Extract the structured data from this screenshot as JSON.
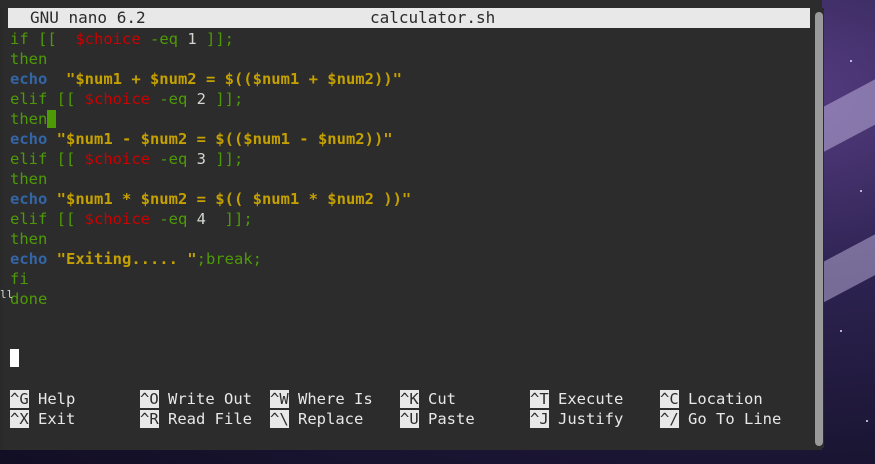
{
  "titlebar": {
    "app": "GNU nano 6.2",
    "file": "calculator.sh"
  },
  "code": [
    [
      {
        "t": "if [[  ",
        "c": "kw"
      },
      {
        "t": "$choice",
        "c": "var"
      },
      {
        "t": " -eq ",
        "c": "kw"
      },
      {
        "t": "1",
        "c": "num"
      },
      {
        "t": " ]];",
        "c": "kw"
      }
    ],
    [
      {
        "t": "then",
        "c": "kw"
      }
    ],
    [
      {
        "t": "echo",
        "c": "echo"
      },
      {
        "t": "  \"$num1 + $num2 = $(($num1 + $num2))\"",
        "c": "str"
      }
    ],
    [
      {
        "t": "elif [[ ",
        "c": "kw"
      },
      {
        "t": "$choice",
        "c": "var"
      },
      {
        "t": " -eq ",
        "c": "kw"
      },
      {
        "t": "2",
        "c": "num"
      },
      {
        "t": " ]];",
        "c": "kw"
      }
    ],
    [
      {
        "t": "then",
        "c": "kw"
      },
      {
        "t": "",
        "c": "cursor"
      }
    ],
    [
      {
        "t": "echo",
        "c": "echo"
      },
      {
        "t": " \"$num1 - $num2 = $(($num1 - $num2))\"",
        "c": "str"
      }
    ],
    [
      {
        "t": "elif [[ ",
        "c": "kw"
      },
      {
        "t": "$choice",
        "c": "var"
      },
      {
        "t": " -eq ",
        "c": "kw"
      },
      {
        "t": "3",
        "c": "num"
      },
      {
        "t": " ]];",
        "c": "kw"
      }
    ],
    [
      {
        "t": "then",
        "c": "kw"
      }
    ],
    [
      {
        "t": "echo",
        "c": "echo"
      },
      {
        "t": " \"$num1 * $num2 = $(( $num1 * $num2 ))\"",
        "c": "str"
      }
    ],
    [
      {
        "t": "elif [[ ",
        "c": "kw"
      },
      {
        "t": "$choice",
        "c": "var"
      },
      {
        "t": " -eq ",
        "c": "kw"
      },
      {
        "t": "4",
        "c": "num"
      },
      {
        "t": "  ]];",
        "c": "kw"
      }
    ],
    [
      {
        "t": "then",
        "c": "kw"
      }
    ],
    [
      {
        "t": "echo",
        "c": "echo"
      },
      {
        "t": " \"Exiting..... \"",
        "c": "str"
      },
      {
        "t": ";break;",
        "c": "kw"
      }
    ],
    [
      {
        "t": "fi",
        "c": "kw"
      }
    ],
    [
      {
        "t": "done",
        "c": "kw"
      }
    ]
  ],
  "shortcuts": [
    {
      "key": "^G",
      "label": "Help"
    },
    {
      "key": "^X",
      "label": "Exit"
    },
    {
      "key": "^O",
      "label": "Write Out"
    },
    {
      "key": "^R",
      "label": "Read File"
    },
    {
      "key": "^W",
      "label": "Where Is"
    },
    {
      "key": "^\\",
      "label": "Replace"
    },
    {
      "key": "^K",
      "label": "Cut"
    },
    {
      "key": "^U",
      "label": "Paste"
    },
    {
      "key": "^T",
      "label": "Execute"
    },
    {
      "key": "^J",
      "label": "Justify"
    },
    {
      "key": "^C",
      "label": "Location"
    },
    {
      "key": "^/",
      "label": "Go To Line"
    }
  ]
}
